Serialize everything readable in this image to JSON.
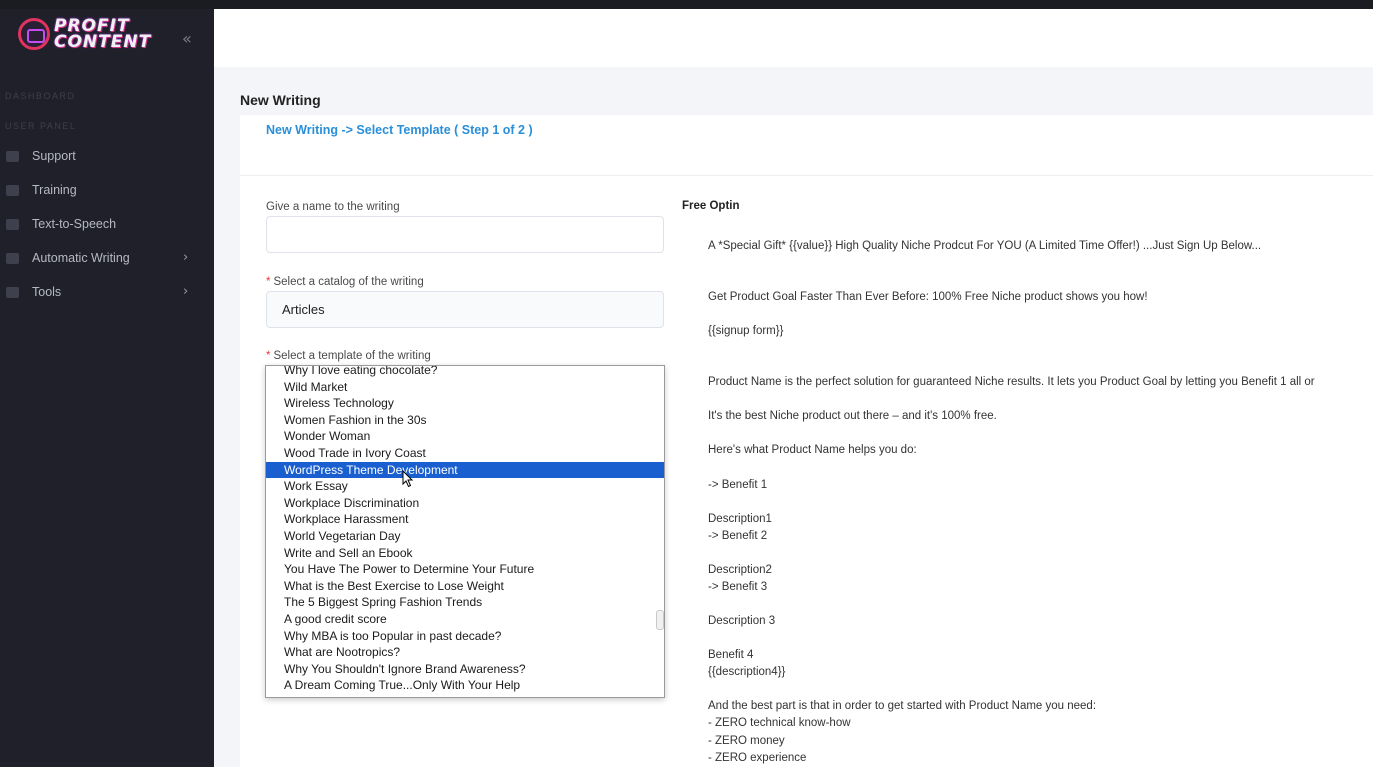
{
  "brand": {
    "line1": "PROFIT",
    "line2": "CONTENT"
  },
  "sidebar": {
    "section1": "DASHBOARD",
    "section2": "USER PANEL",
    "items": [
      {
        "label": "Support",
        "has_submenu": false
      },
      {
        "label": "Training",
        "has_submenu": false
      },
      {
        "label": "Text-to-Speech",
        "has_submenu": false
      },
      {
        "label": "Automatic Writing",
        "has_submenu": true
      },
      {
        "label": "Tools",
        "has_submenu": true
      }
    ]
  },
  "page": {
    "title": "New Writing",
    "breadcrumb": "New Writing -> Select Template ( Step 1 of 2 )"
  },
  "form": {
    "name_label": "Give a name to the writing",
    "name_value": "",
    "catalog_label": "Select a catalog of the writing",
    "catalog_value": "Articles",
    "template_label": "Select a template of the writing",
    "required_mark": "*"
  },
  "dropdown": {
    "selected": "WordPress Theme Development",
    "options": [
      "Why I love eating chocolate?",
      "Wild Market",
      "Wireless Technology",
      "Women Fashion in the 30s",
      "Wonder Woman",
      "Wood Trade in Ivory Coast",
      "WordPress Theme Development",
      "Work Essay",
      "Workplace Discrimination",
      "Workplace Harassment",
      "World Vegetarian Day",
      "Write and Sell an Ebook",
      "You Have The Power to Determine Your Future",
      "What is the Best Exercise to Lose Weight",
      "The 5 Biggest Spring Fashion Trends",
      "A good credit score",
      "Why MBA is too Popular in past decade?",
      "What are Nootropics?",
      "Why You Shouldn't Ignore Brand Awareness?",
      "A Dream Coming True...Only With Your Help"
    ]
  },
  "preview": {
    "title": "Free Optin",
    "lines": [
      "A *Special Gift* {{value}} High Quality Niche Prodcut For YOU (A Limited Time Offer!) ...Just Sign Up Below...",
      "Get Product Goal Faster Than Ever Before: 100% Free Niche product shows you how!",
      "{{signup form}}",
      "Product Name is the perfect solution for guaranteed Niche results. It lets you Product Goal by letting you Benefit 1 all or",
      "It's the best Niche product out there – and it's 100% free.",
      "Here's what Product Name helps you do:",
      "-> Benefit 1",
      "Description1",
      "-> Benefit 2",
      "Description2",
      "-> Benefit 3",
      "Description 3",
      "Benefit 4",
      "{{description4}}",
      "And the best part is that in order to get started with Product Name you need:",
      "- ZERO technical know-how",
      "- ZERO money",
      "- ZERO experience"
    ]
  },
  "colors": {
    "sidebar_bg": "#1f2029",
    "accent_link": "#2a8fd9",
    "selection": "#1a5fd0",
    "required": "#e03a3a"
  }
}
